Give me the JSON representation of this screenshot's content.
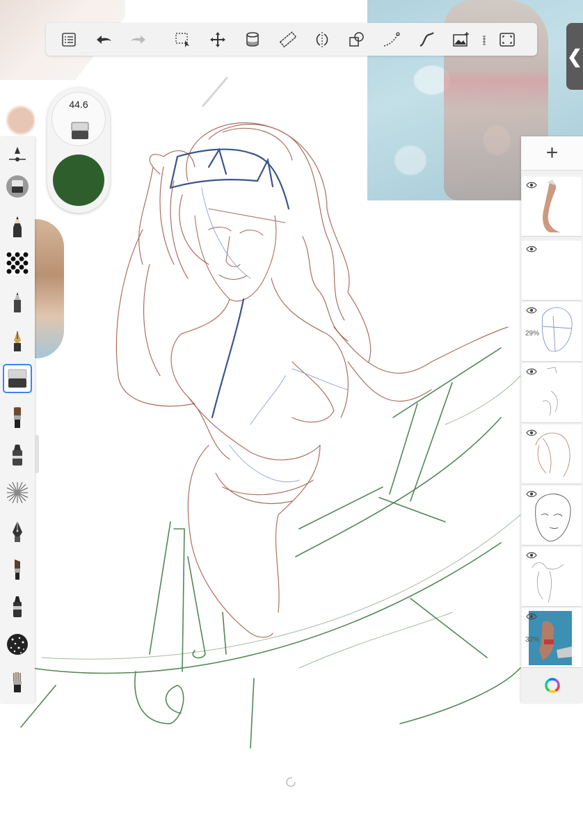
{
  "app": {
    "brush_size": "44.6",
    "current_color": "#2e5e2c"
  },
  "toolbar": {
    "items": [
      {
        "id": "menu",
        "icon": "list-menu-icon"
      },
      {
        "id": "undo",
        "icon": "undo-arrow-icon"
      },
      {
        "id": "redo",
        "icon": "redo-arrow-icon"
      },
      {
        "id": "select",
        "icon": "selection-icon"
      },
      {
        "id": "transform",
        "icon": "move-transform-icon"
      },
      {
        "id": "fill",
        "icon": "paint-bucket-icon"
      },
      {
        "id": "ruler",
        "icon": "ruler-icon"
      },
      {
        "id": "symmetry",
        "icon": "symmetry-icon"
      },
      {
        "id": "shapes",
        "icon": "shapes-icon"
      },
      {
        "id": "perspective",
        "icon": "perspective-curve-icon"
      },
      {
        "id": "stroke",
        "icon": "predictive-stroke-icon"
      },
      {
        "id": "image",
        "icon": "add-image-icon"
      },
      {
        "id": "text",
        "icon": "text-icon"
      },
      {
        "id": "fullscreen",
        "icon": "fullscreen-icon"
      }
    ]
  },
  "panel_toggle": {
    "label": "❮"
  },
  "brush_palette": {
    "items": [
      {
        "id": "brush-settings",
        "icon": "brush-settings-slider-icon"
      },
      {
        "id": "eraser-puck",
        "icon": "eraser-icon"
      },
      {
        "id": "pencil",
        "icon": "pencil-icon"
      },
      {
        "id": "dot-pattern",
        "icon": "dot-pattern-brush-icon"
      },
      {
        "id": "ballpoint",
        "icon": "ballpoint-pen-icon"
      },
      {
        "id": "ink-pen",
        "icon": "ink-pen-icon"
      },
      {
        "id": "eraser",
        "icon": "eraser-icon",
        "selected": true
      },
      {
        "id": "paintbrush",
        "icon": "paintbrush-icon"
      },
      {
        "id": "marker",
        "icon": "marker-icon"
      },
      {
        "id": "airbrush",
        "icon": "airbrush-spray-icon"
      },
      {
        "id": "fountain-pen",
        "icon": "fountain-pen-icon"
      },
      {
        "id": "flat-brush",
        "icon": "flat-brush-icon"
      },
      {
        "id": "felt-marker",
        "icon": "felt-marker-icon"
      },
      {
        "id": "texture",
        "icon": "texture-brush-icon"
      },
      {
        "id": "bristle",
        "icon": "bristle-brush-icon"
      }
    ]
  },
  "layers": {
    "add_label": "+",
    "items": [
      {
        "name": "layer-reference-arm",
        "opacity": ""
      },
      {
        "name": "layer-empty",
        "opacity": ""
      },
      {
        "name": "layer-head-construction",
        "opacity": "29%"
      },
      {
        "name": "layer-face-sketch",
        "opacity": ""
      },
      {
        "name": "layer-hair-sketch",
        "opacity": ""
      },
      {
        "name": "layer-face-detail",
        "opacity": ""
      },
      {
        "name": "layer-body-sketch",
        "opacity": ""
      },
      {
        "name": "layer-pool-photo",
        "opacity": "32%"
      }
    ]
  },
  "colors": {
    "brown_sketch": "#9c5646",
    "blue_sketch": "#27427e",
    "light_blue_sketch": "#7d93c8",
    "green_sketch": "#3f7a43",
    "accent_selected": "#3c84f2"
  }
}
